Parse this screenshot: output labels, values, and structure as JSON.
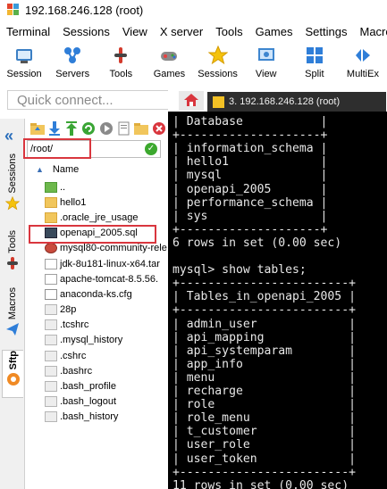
{
  "window": {
    "title": "192.168.246.128 (root)"
  },
  "menu": [
    "Terminal",
    "Sessions",
    "View",
    "X server",
    "Tools",
    "Games",
    "Settings",
    "Macro"
  ],
  "toolbar": [
    {
      "label": "Session",
      "icon": "session-icon"
    },
    {
      "label": "Servers",
      "icon": "servers-icon"
    },
    {
      "label": "Tools",
      "icon": "tools-icon"
    },
    {
      "label": "Games",
      "icon": "games-icon"
    },
    {
      "label": "Sessions",
      "icon": "star-icon"
    },
    {
      "label": "View",
      "icon": "view-icon"
    },
    {
      "label": "Split",
      "icon": "split-icon"
    },
    {
      "label": "MultiEx",
      "icon": "multiexec-icon"
    }
  ],
  "quick_connect": {
    "placeholder": "Quick connect..."
  },
  "tabs": {
    "active_label": "3. 192.168.246.128 (root)"
  },
  "side_tabs": [
    "Sessions",
    "Tools",
    "Macros",
    "Sftp"
  ],
  "sftp": {
    "path": "/root/",
    "name_header": "Name",
    "files": [
      {
        "name": "..",
        "type": "up"
      },
      {
        "name": "hello1",
        "type": "folder"
      },
      {
        "name": ".oracle_jre_usage",
        "type": "folder"
      },
      {
        "name": "openapi_2005.sql",
        "type": "sql"
      },
      {
        "name": "mysql80-community-rele",
        "type": "rpm"
      },
      {
        "name": "jdk-8u181-linux-x64.tar",
        "type": "tar"
      },
      {
        "name": "apache-tomcat-8.5.56.",
        "type": "tar"
      },
      {
        "name": "anaconda-ks.cfg",
        "type": "cfg"
      },
      {
        "name": "28p",
        "type": "file"
      },
      {
        "name": ".tcshrc",
        "type": "file"
      },
      {
        "name": ".mysql_history",
        "type": "file"
      },
      {
        "name": ".cshrc",
        "type": "file"
      },
      {
        "name": ".bashrc",
        "type": "file"
      },
      {
        "name": ".bash_profile",
        "type": "file"
      },
      {
        "name": ".bash_logout",
        "type": "file"
      },
      {
        "name": ".bash_history",
        "type": "file"
      }
    ]
  },
  "terminal": {
    "lines": [
      "| Database           |",
      "+--------------------+",
      "| information_schema |",
      "| hello1             |",
      "| mysql              |",
      "| openapi_2005       |",
      "| performance_schema |",
      "| sys                |",
      "+--------------------+",
      "6 rows in set (0.00 sec)",
      "",
      "mysql> show tables;",
      "+------------------------+",
      "| Tables_in_openapi_2005 |",
      "+------------------------+",
      "| admin_user             |",
      "| api_mapping            |",
      "| api_systemparam        |",
      "| app_info               |",
      "| menu                   |",
      "| recharge               |",
      "| role                   |",
      "| role_menu              |",
      "| t_customer             |",
      "| user_role              |",
      "| user_token             |",
      "+------------------------+",
      "11 rows in set (0.00 sec)"
    ]
  }
}
